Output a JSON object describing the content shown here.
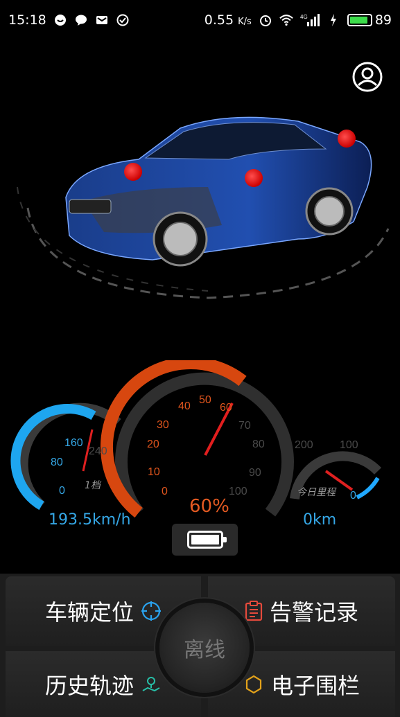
{
  "status_bar": {
    "time": "15:18",
    "net_speed": "0.55",
    "net_unit": "K/s",
    "signal": "4G",
    "battery_level": "89"
  },
  "dashboard": {
    "speed_text": "193.5km/h",
    "gear_text": "1档",
    "percent_text": "60%",
    "today_mileage_label": "今日里程",
    "today_mileage_text": "0km",
    "left_ticks": [
      "0",
      "80",
      "160",
      "240"
    ],
    "center_ticks": [
      "0",
      "10",
      "20",
      "30",
      "40",
      "50",
      "60",
      "70",
      "80",
      "90",
      "100"
    ],
    "right_ticks": [
      "200",
      "100",
      "0"
    ]
  },
  "buttons": {
    "locate": "车辆定位",
    "alarm": "告警记录",
    "history": "历史轨迹",
    "fence": "电子围栏",
    "center": "离线"
  }
}
